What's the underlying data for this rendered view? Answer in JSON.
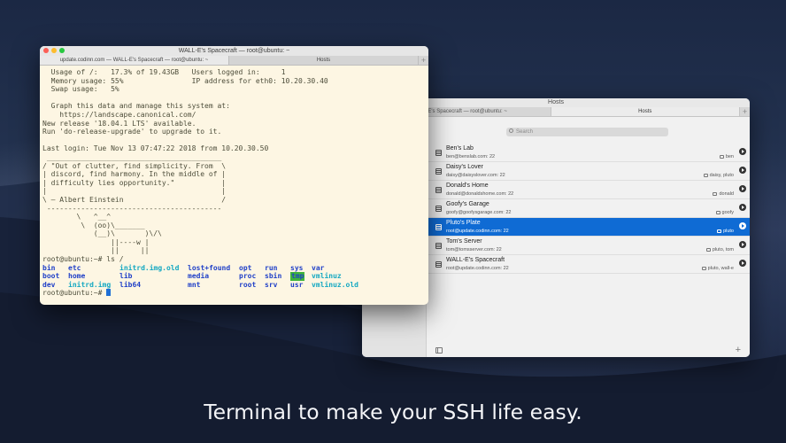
{
  "caption": "Terminal to make your SSH life easy.",
  "colors": {
    "selection_blue": "#0f6bd4",
    "terminal_background": "#fdf6e3",
    "ls_directory": "#2040c8",
    "ls_file": "#14a8c2",
    "ls_tmp_highlight": "#3fb43a",
    "traffic_close": "#fc5f57",
    "traffic_minimize": "#fdbc2e",
    "traffic_maximize": "#28c840"
  },
  "terminal": {
    "title": "WALL-E's Spacecraft — root@ubuntu: ~",
    "tabs": [
      {
        "label": "update.codinn.com — WALL-E's Spacecraft — root@ubuntu: ~",
        "active": true
      },
      {
        "label": "Hosts",
        "active": false
      }
    ],
    "lines": [
      "  Usage of /:   17.3% of 19.43GB   Users logged in:     1",
      "  Memory usage: 55%                IP address for eth0: 10.20.30.40",
      "  Swap usage:   5%",
      "",
      "  Graph this data and manage this system at:",
      "    https://landscape.canonical.com/",
      "New release '18.04.1 LTS' available.",
      "Run 'do-release-upgrade' to upgrade to it.",
      "",
      "Last login: Tue Nov 13 07:47:22 2018 from 10.20.30.50",
      " _________________________________________",
      "/ \"Out of clutter, find simplicity. From  \\",
      "| discord, find harmony. In the middle of |",
      "| difficulty lies opportunity.\"           |",
      "|                                         |",
      "\\ — Albert Einstein                       /",
      " -----------------------------------------",
      "        \\   ^__^",
      "         \\  (oo)\\_______",
      "            (__)\\       )\\/\\",
      "                ||----w |",
      "                ||     ||",
      "root@ubuntu:~# ls /"
    ],
    "ls_rows": [
      [
        {
          "text": "bin",
          "kind": "dir"
        },
        {
          "text": "etc",
          "kind": "dir"
        },
        {
          "text": "initrd.img.old",
          "kind": "file"
        },
        {
          "text": "lost+found",
          "kind": "dir"
        },
        {
          "text": "opt",
          "kind": "dir"
        },
        {
          "text": "run",
          "kind": "dir"
        },
        {
          "text": "sys",
          "kind": "dir"
        },
        {
          "text": "var",
          "kind": "dir"
        }
      ],
      [
        {
          "text": "boot",
          "kind": "dir"
        },
        {
          "text": "home",
          "kind": "dir"
        },
        {
          "text": "lib",
          "kind": "dir"
        },
        {
          "text": "media",
          "kind": "dir"
        },
        {
          "text": "proc",
          "kind": "dir"
        },
        {
          "text": "sbin",
          "kind": "dir"
        },
        {
          "text": "tmp",
          "kind": "tmp"
        },
        {
          "text": "vmlinuz",
          "kind": "file"
        }
      ],
      [
        {
          "text": "dev",
          "kind": "dir"
        },
        {
          "text": "initrd.img",
          "kind": "file"
        },
        {
          "text": "lib64",
          "kind": "dir"
        },
        {
          "text": "mnt",
          "kind": "dir"
        },
        {
          "text": "root",
          "kind": "dir"
        },
        {
          "text": "srv",
          "kind": "dir"
        },
        {
          "text": "usr",
          "kind": "dir"
        },
        {
          "text": "vmlinuz.old",
          "kind": "file"
        }
      ]
    ],
    "prompt": "root@ubuntu:~# "
  },
  "hosts": {
    "title": "Hosts",
    "tabs": [
      {
        "label": "… WALL-E's Spacecraft — root@ubuntu: ~",
        "active": false
      },
      {
        "label": "Hosts",
        "active": true
      }
    ],
    "search_placeholder": "Search",
    "items": [
      {
        "name": "Ben's Lab",
        "address": "ben@benslab.com: 22",
        "tags": "ben",
        "selected": false
      },
      {
        "name": "Daisy's Lover",
        "address": "daisy@daisyslover.com: 22",
        "tags": "daisy, pluto",
        "selected": false
      },
      {
        "name": "Donald's Home",
        "address": "donald@donaldshome.com: 22",
        "tags": "donald",
        "selected": false
      },
      {
        "name": "Goofy's Garage",
        "address": "goofy@goofysgarage.com: 22",
        "tags": "goofy",
        "selected": false
      },
      {
        "name": "Pluto's Plate",
        "address": "root@update.codinn.com: 22",
        "tags": "pluto",
        "selected": true
      },
      {
        "name": "Tom's Server",
        "address": "tom@tomsserver.com: 22",
        "tags": "pluto, tom",
        "selected": false
      },
      {
        "name": "WALL-E's Spacecraft",
        "address": "root@update.codinn.com: 22",
        "tags": "pluto, wall-e",
        "selected": false
      }
    ]
  }
}
